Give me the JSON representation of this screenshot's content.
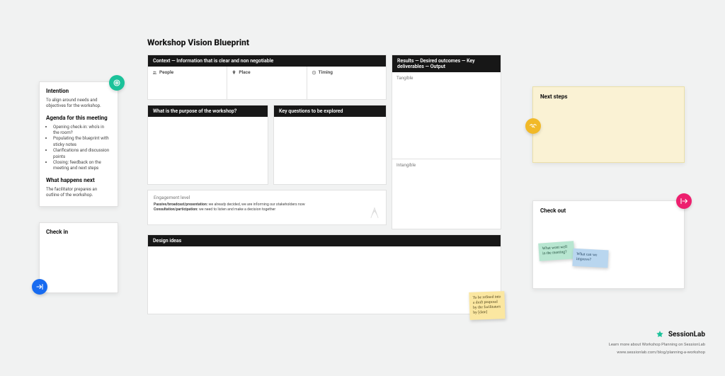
{
  "page_title": "Workshop Vision Blueprint",
  "left": {
    "intention": {
      "title": "Intention",
      "body": "To align around needs and objectives for the workshop."
    },
    "agenda": {
      "title": "Agenda for this meeting",
      "items": [
        "Opening check-in: who's in the room?",
        "Populating the blueprint with sticky notes",
        "Clarifications and discussion points",
        "Closing: feedback on the meeting and next steps"
      ]
    },
    "what_next": {
      "title": "What happens next",
      "body": "The facilitator prepares an outline of the workshop."
    },
    "check_in": {
      "title": "Check in"
    }
  },
  "blueprint": {
    "context": {
      "heading": "Context — Information that is clear and non negotiable",
      "cells": {
        "people": "People",
        "place": "Place",
        "timing": "Timing"
      }
    },
    "purpose": {
      "heading": "What is the purpose of the workshop?"
    },
    "key_questions": {
      "heading": "Key questions to be explored"
    },
    "results": {
      "heading": "Results — Desired outcomes — Key deliverables — Output",
      "tangible": "Tangible",
      "intangible": "Intangible"
    },
    "engagement": {
      "title": "Engagement level",
      "grade1_label": "Passive/broadcast/presentation:",
      "grade1_body": "we already decided, we are informing our stakeholders now",
      "grade2_label": "Consultation/participation:",
      "grade2_body": "we need to listen and make a decision together"
    },
    "design": {
      "heading": "Design ideas",
      "sticky": "To be refined into a draft proposal by the facilitators by [date]"
    }
  },
  "right": {
    "next_steps": {
      "title": "Next steps"
    },
    "check_out": {
      "title": "Check out",
      "sticky_good": "What went well in the meeting?",
      "sticky_improve": "What can we improve?"
    }
  },
  "brand": {
    "name": "SessionLab",
    "line1": "Learn more about Workshop Planning on SessionLab",
    "line2": "www.sessionlab.com/blog/planning-a-workshop"
  },
  "icons": {
    "target": "target-icon",
    "arrow_in": "enter-icon",
    "handshake": "handshake-icon",
    "arrow_out": "exit-icon"
  }
}
